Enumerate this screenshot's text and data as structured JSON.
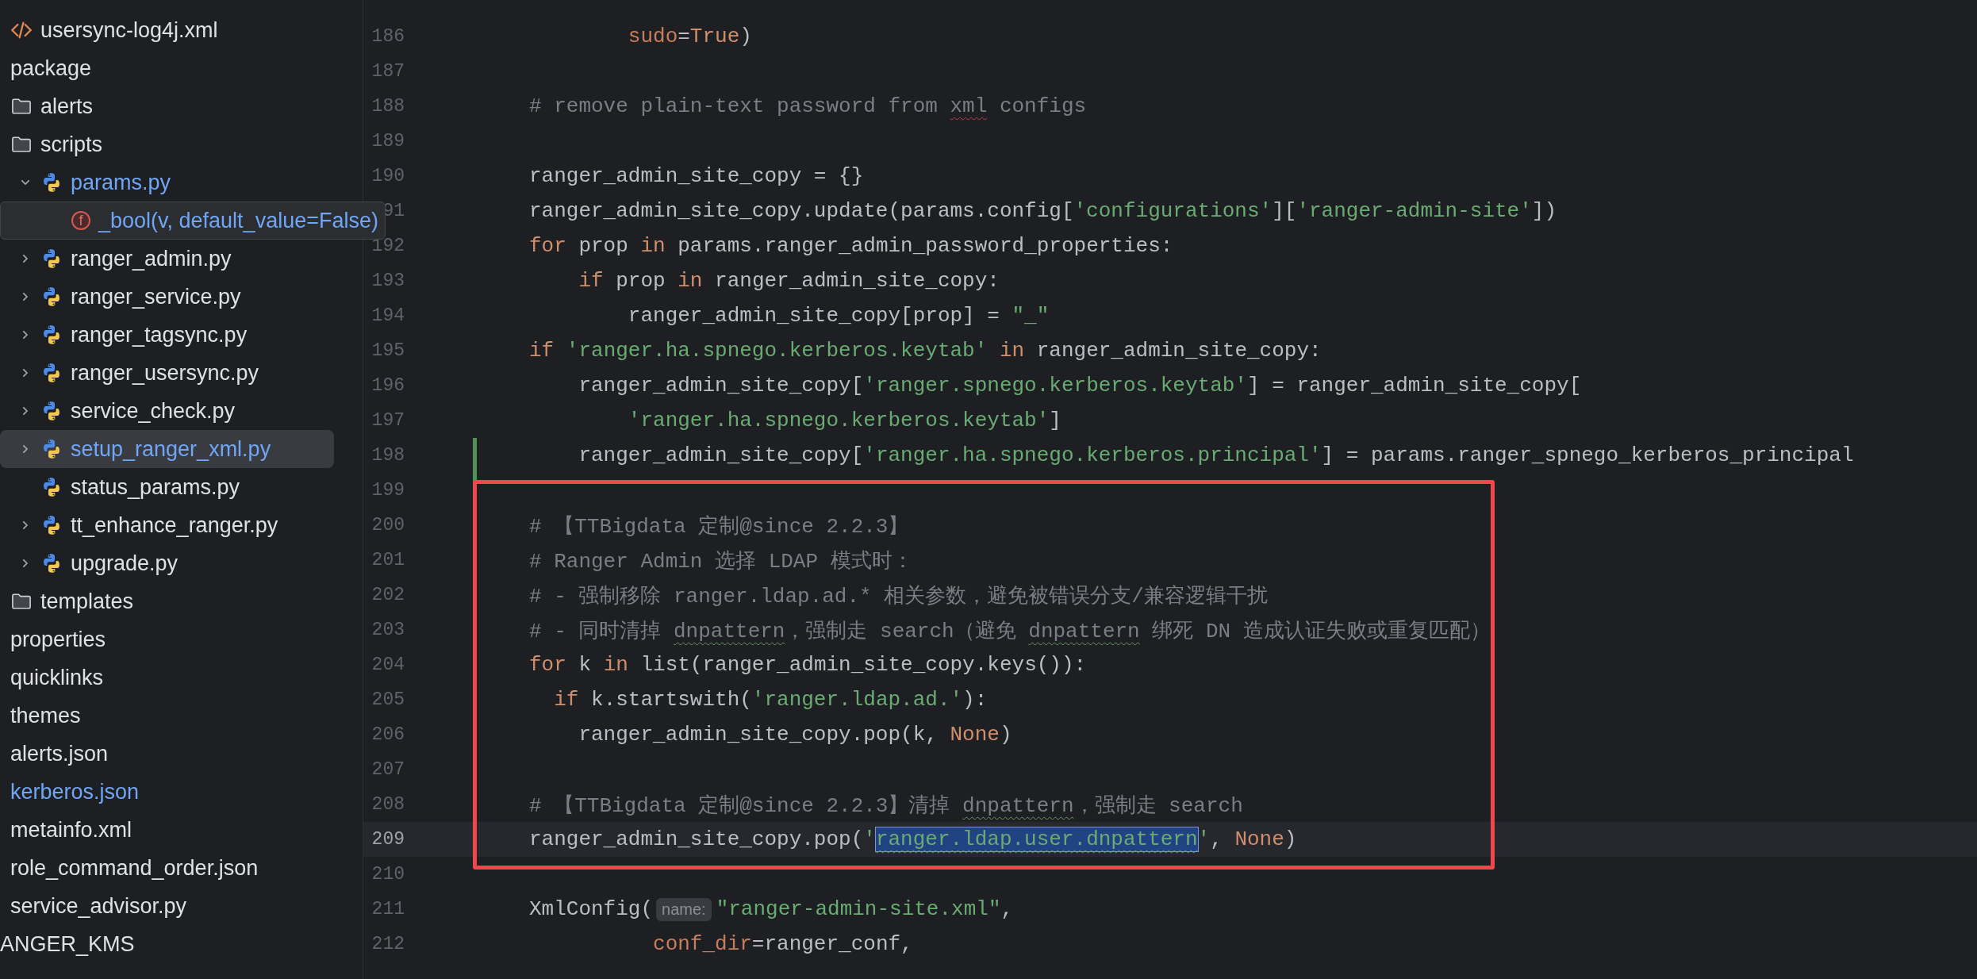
{
  "sidebar": {
    "tree": [
      {
        "children": [
          {
            "children": [
              {
                "kind": "xml",
                "label": "usersync-log4j.xml",
                "selected": false,
                "modified": false,
                "hovered": false
              }
            ]
          },
          {
            "label": "package",
            "selected": false,
            "modified": false,
            "hovered": false,
            "children": [
              {
                "kind": "folder",
                "label": "alerts",
                "selected": false,
                "modified": false,
                "hovered": false
              },
              {
                "kind": "folder",
                "label": "scripts",
                "selected": false,
                "modified": false,
                "hovered": false,
                "children": [
                  {
                    "kind": "python",
                    "label": "params.py",
                    "expanded": true,
                    "selected": false,
                    "modified": true,
                    "hovered": false,
                    "children": [
                      {
                        "kind": "function",
                        "badge": "f",
                        "label": "_bool(v, default_value=False)",
                        "selected": false,
                        "modified": true,
                        "hovered": true
                      }
                    ]
                  },
                  {
                    "kind": "python",
                    "label": "ranger_admin.py",
                    "expanded": false,
                    "selected": false,
                    "modified": false,
                    "hovered": false
                  },
                  {
                    "kind": "python",
                    "label": "ranger_service.py",
                    "expanded": false,
                    "selected": false,
                    "modified": false,
                    "hovered": false
                  },
                  {
                    "kind": "python",
                    "label": "ranger_tagsync.py",
                    "expanded": false,
                    "selected": false,
                    "modified": false,
                    "hovered": false
                  },
                  {
                    "kind": "python",
                    "label": "ranger_usersync.py",
                    "expanded": false,
                    "selected": false,
                    "modified": false,
                    "hovered": false
                  },
                  {
                    "kind": "python",
                    "label": "service_check.py",
                    "expanded": false,
                    "selected": false,
                    "modified": false,
                    "hovered": false
                  },
                  {
                    "kind": "python",
                    "label": "setup_ranger_xml.py",
                    "expanded": false,
                    "selected": true,
                    "modified": true,
                    "hovered": false
                  },
                  {
                    "kind": "python",
                    "label": "status_params.py",
                    "selected": false,
                    "modified": false,
                    "hovered": false
                  },
                  {
                    "kind": "python",
                    "label": "tt_enhance_ranger.py",
                    "expanded": false,
                    "selected": false,
                    "modified": false,
                    "hovered": false
                  },
                  {
                    "kind": "python",
                    "label": "upgrade.py",
                    "expanded": false,
                    "selected": false,
                    "modified": false,
                    "hovered": false
                  }
                ]
              },
              {
                "kind": "folder",
                "label": "templates",
                "selected": false,
                "modified": false,
                "hovered": false
              }
            ]
          },
          {
            "label": "properties",
            "selected": false,
            "modified": false,
            "hovered": false
          },
          {
            "label": "quicklinks",
            "selected": false,
            "modified": false,
            "hovered": false
          },
          {
            "label": "themes",
            "selected": false,
            "modified": false,
            "hovered": false
          },
          {
            "label": "alerts.json",
            "selected": false,
            "modified": false,
            "hovered": false
          },
          {
            "label": "kerberos.json",
            "selected": false,
            "modified": true,
            "hovered": false
          },
          {
            "label": "metainfo.xml",
            "selected": false,
            "modified": false,
            "hovered": false
          },
          {
            "label": "role_command_order.json",
            "selected": false,
            "modified": false,
            "hovered": false
          },
          {
            "label": "service_advisor.py",
            "selected": false,
            "modified": false,
            "hovered": false
          }
        ]
      },
      {
        "label": "ANGER_KMS",
        "selected": false,
        "modified": false,
        "hovered": false
      }
    ]
  },
  "editor": {
    "lines": [
      {
        "number": "186",
        "current": false,
        "changed": false,
        "tokens": [
          {
            "kind": "arg",
            "text": "        sudo"
          },
          {
            "kind": "plain",
            "text": "="
          },
          {
            "kind": "kw",
            "text": "True"
          },
          {
            "kind": "plain",
            "text": ")"
          }
        ]
      },
      {
        "number": "187",
        "current": false,
        "changed": false
      },
      {
        "number": "188",
        "current": false,
        "changed": false,
        "tokens": [
          {
            "kind": "cmt",
            "text": "# remove plain-text password from "
          },
          {
            "kind": "warn",
            "text": "xml"
          },
          {
            "kind": "cmt",
            "text": " configs"
          }
        ]
      },
      {
        "number": "189",
        "current": false,
        "changed": false
      },
      {
        "number": "190",
        "current": false,
        "changed": false,
        "tokens": [
          {
            "kind": "plain",
            "text": "ranger_admin_site_copy = {}"
          }
        ]
      },
      {
        "number": "91",
        "current": false,
        "changed": false,
        "tokens": [
          {
            "kind": "plain",
            "text": "ranger_admin_site_copy.update(params.config["
          },
          {
            "kind": "str",
            "text": "'configurations'"
          },
          {
            "kind": "plain",
            "text": "]["
          },
          {
            "kind": "str",
            "text": "'ranger-admin-site'"
          },
          {
            "kind": "plain",
            "text": "])"
          }
        ]
      },
      {
        "number": "192",
        "current": false,
        "changed": false,
        "tokens": [
          {
            "kind": "kw",
            "text": "for"
          },
          {
            "kind": "plain",
            "text": " prop "
          },
          {
            "kind": "kw",
            "text": "in"
          },
          {
            "kind": "plain",
            "text": " params.ranger_admin_password_properties:"
          }
        ]
      },
      {
        "number": "193",
        "current": false,
        "changed": false,
        "tokens": [
          {
            "kind": "kw",
            "text": "    if"
          },
          {
            "kind": "plain",
            "text": " prop "
          },
          {
            "kind": "kw",
            "text": "in"
          },
          {
            "kind": "plain",
            "text": " ranger_admin_site_copy:"
          }
        ]
      },
      {
        "number": "194",
        "current": false,
        "changed": false,
        "tokens": [
          {
            "kind": "plain",
            "text": "        ranger_admin_site_copy[prop] = "
          },
          {
            "kind": "str",
            "text": "\"_\""
          }
        ]
      },
      {
        "number": "195",
        "current": false,
        "changed": false,
        "tokens": [
          {
            "kind": "kw",
            "text": "if"
          },
          {
            "kind": "str",
            "text": " 'ranger.ha.spnego.kerberos.keytab' "
          },
          {
            "kind": "kw",
            "text": "in"
          },
          {
            "kind": "plain",
            "text": " ranger_admin_site_copy:"
          }
        ]
      },
      {
        "number": "196",
        "current": false,
        "changed": false,
        "tokens": [
          {
            "kind": "plain",
            "text": "    ranger_admin_site_copy["
          },
          {
            "kind": "str",
            "text": "'ranger.spnego.kerberos.keytab'"
          },
          {
            "kind": "plain",
            "text": "] = ranger_admin_site_copy["
          }
        ]
      },
      {
        "number": "197",
        "current": false,
        "changed": false,
        "tokens": [
          {
            "kind": "str",
            "text": "        'ranger.ha.spnego.kerberos.keytab'"
          },
          {
            "kind": "plain",
            "text": "]"
          }
        ]
      },
      {
        "number": "198",
        "current": false,
        "changed": true,
        "tokens": [
          {
            "kind": "plain",
            "text": "    ranger_admin_site_copy["
          },
          {
            "kind": "str",
            "text": "'ranger.ha.spnego.kerberos.principal'"
          },
          {
            "kind": "plain",
            "text": "] = params.ranger_spnego_kerberos_principal"
          }
        ]
      },
      {
        "number": "199",
        "current": false,
        "changed": true
      },
      {
        "number": "200",
        "current": false,
        "changed": true,
        "tokens": [
          {
            "kind": "cmt",
            "text": "# 【TTBigdata 定制@since 2.2.3】"
          }
        ]
      },
      {
        "number": "201",
        "current": false,
        "changed": true,
        "tokens": [
          {
            "kind": "cmt",
            "text": "# Ranger Admin 选择 LDAP 模式时："
          }
        ]
      },
      {
        "number": "202",
        "current": false,
        "changed": true,
        "tokens": [
          {
            "kind": "cmt",
            "text": "# - 强制移除 ranger.ldap.ad.* 相关参数，避免被错误分支/兼容逻辑干扰"
          }
        ]
      },
      {
        "number": "203",
        "current": false,
        "changed": true,
        "tokens": [
          {
            "kind": "cmt",
            "text": "# - 同时清掉 "
          },
          {
            "kind": "typo",
            "text": "dnpattern"
          },
          {
            "kind": "cmt",
            "text": "，强制走 search（避免 "
          },
          {
            "kind": "typo",
            "text": "dnpattern"
          },
          {
            "kind": "cmt",
            "text": " 绑死 DN 造成认证失败或重复匹配）"
          }
        ]
      },
      {
        "number": "204",
        "current": false,
        "changed": true,
        "tokens": [
          {
            "kind": "kw",
            "text": "for"
          },
          {
            "kind": "plain",
            "text": " k "
          },
          {
            "kind": "kw",
            "text": "in"
          },
          {
            "kind": "plain",
            "text": " list(ranger_admin_site_copy.keys()):"
          }
        ]
      },
      {
        "number": "205",
        "current": false,
        "changed": true,
        "tokens": [
          {
            "kind": "kw",
            "text": "  if"
          },
          {
            "kind": "plain",
            "text": " k.startswith("
          },
          {
            "kind": "str",
            "text": "'ranger.ldap.ad.'"
          },
          {
            "kind": "plain",
            "text": "):"
          }
        ]
      },
      {
        "number": "206",
        "current": false,
        "changed": true,
        "tokens": [
          {
            "kind": "plain",
            "text": "    ranger_admin_site_copy.pop(k, "
          },
          {
            "kind": "kw",
            "text": "None"
          },
          {
            "kind": "plain",
            "text": ")"
          }
        ]
      },
      {
        "number": "207",
        "current": false,
        "changed": true
      },
      {
        "number": "208",
        "current": false,
        "changed": true,
        "tokens": [
          {
            "kind": "cmt",
            "text": "# 【TTBigdata 定制@since 2.2.3】清掉 "
          },
          {
            "kind": "typo",
            "text": "dnpattern"
          },
          {
            "kind": "cmt",
            "text": "，强制走 search"
          }
        ]
      },
      {
        "number": "209",
        "current": true,
        "changed": true,
        "tokens": [
          {
            "kind": "plain",
            "text": "ranger_admin_site_copy.pop("
          },
          {
            "kind": "str",
            "text": "'"
          },
          {
            "kind": "sel",
            "text": "ranger.ldap.user.dnpattern"
          },
          {
            "kind": "str",
            "text": "'"
          },
          {
            "kind": "plain",
            "text": ", "
          },
          {
            "kind": "kw",
            "text": "None"
          },
          {
            "kind": "plain",
            "text": ")"
          }
        ]
      },
      {
        "number": "210",
        "current": false,
        "changed": false
      },
      {
        "number": "211",
        "current": false,
        "changed": false,
        "tokens": [
          {
            "kind": "plain",
            "text": "XmlConfig("
          },
          {
            "kind": "hint",
            "text": "name:"
          },
          {
            "kind": "str",
            "text": "\"ranger-admin-site.xml\""
          },
          {
            "kind": "plain",
            "text": ","
          }
        ]
      },
      {
        "number": "212",
        "current": false,
        "changed": false,
        "tokens": [
          {
            "kind": "arg",
            "text": "          conf_dir"
          },
          {
            "kind": "plain",
            "text": "=ranger_conf,"
          }
        ]
      }
    ]
  }
}
